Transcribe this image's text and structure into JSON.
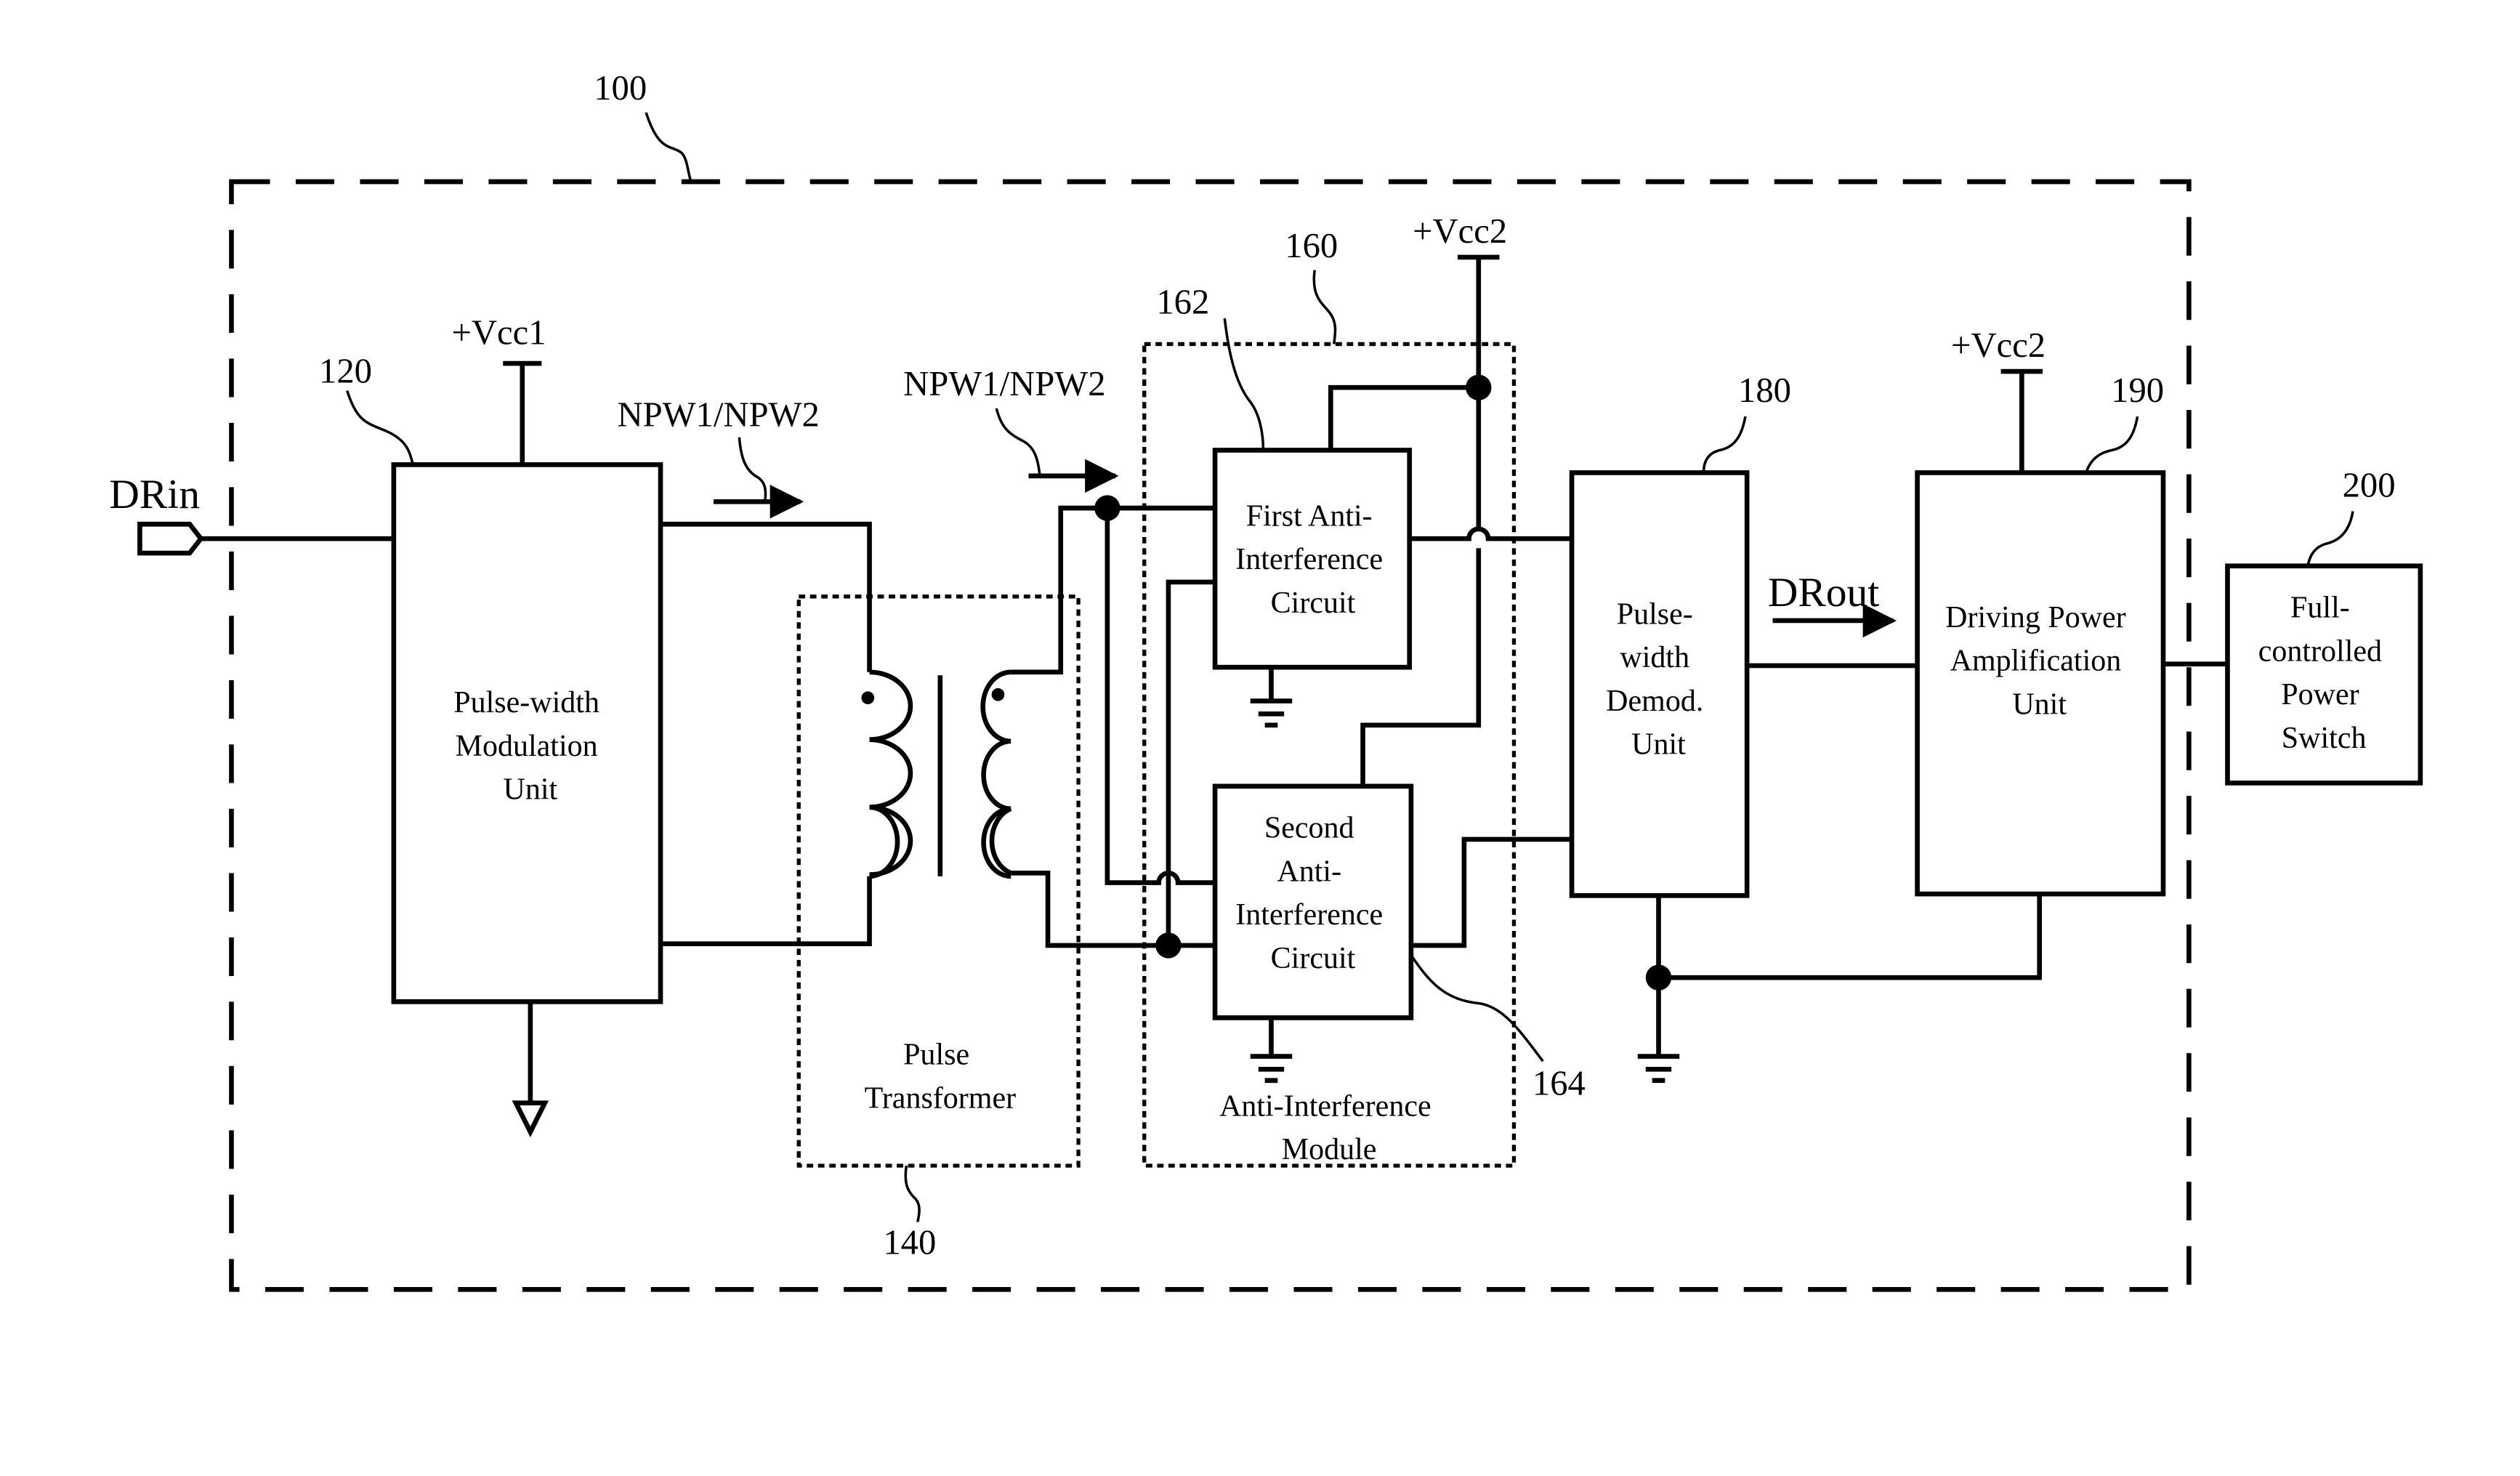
{
  "diagram": {
    "refs": {
      "system": "100",
      "pwm": "120",
      "transformer": "140",
      "module": "160",
      "first": "162",
      "second": "164",
      "demod": "180",
      "amp": "190",
      "switch": "200"
    },
    "signals": {
      "input": "DRin",
      "output": "DRout",
      "npw_left": "NPW1/NPW2",
      "npw_right": "NPW1/NPW2",
      "vcc1": "+Vcc1",
      "vcc2_module": "+Vcc2",
      "vcc2_amp": "+Vcc2"
    },
    "blocks": {
      "pwm": [
        "Pulse-width",
        "Modulation",
        "Unit"
      ],
      "transformer": [
        "Pulse",
        "Transformer"
      ],
      "first": [
        "First Anti-",
        "Interference",
        "Circuit"
      ],
      "second": [
        "Second",
        "Anti-",
        "Interference",
        "Circuit"
      ],
      "module": [
        "Anti-Interference",
        "Module"
      ],
      "demod": [
        "Pulse-",
        "width",
        "Demod.",
        "Unit"
      ],
      "amp": [
        "Driving Power",
        "Amplification",
        "Unit"
      ],
      "switch": [
        "Full-",
        "controlled",
        "Power",
        "Switch"
      ]
    }
  }
}
